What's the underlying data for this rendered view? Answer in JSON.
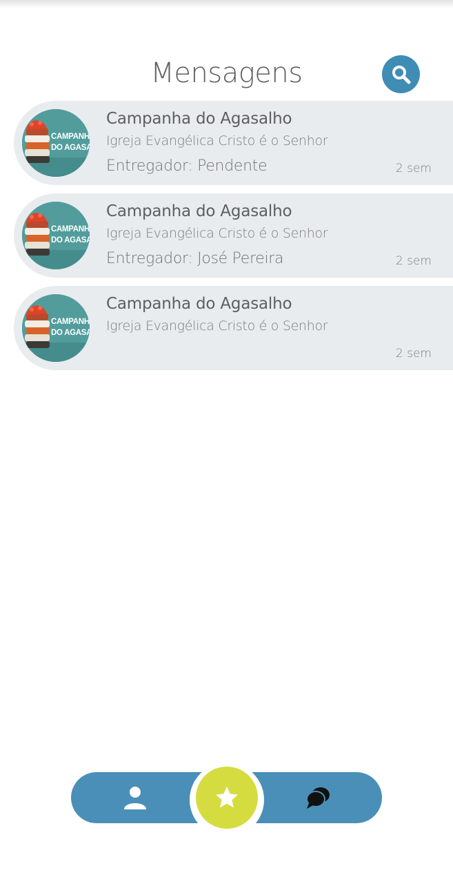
{
  "header": {
    "title": "Mensagens",
    "search_icon": "search-icon"
  },
  "messages": [
    {
      "title": "Campanha do Agasalho",
      "subtitle": "Igreja Evangélica Cristo é o Senhor",
      "deliverer": "Entregador: Pendente",
      "time": "2 sem",
      "avatar_text": [
        "CAMPANHA",
        "DO AGASALHO"
      ]
    },
    {
      "title": "Campanha do Agasalho",
      "subtitle": "Igreja Evangélica Cristo é o Senhor",
      "deliverer": "Entregador: José Pereira",
      "time": "2 sem",
      "avatar_text": [
        "CAMPANHA",
        "DO AGASALHO"
      ]
    },
    {
      "title": "Campanha do Agasalho",
      "subtitle": "Igreja Evangélica Cristo é o Senhor",
      "deliverer": "",
      "time": "2 sem",
      "avatar_text": [
        "CAMPANHA",
        "DO AGASALHO"
      ]
    }
  ],
  "bottom_nav": {
    "items": [
      {
        "icon": "profile-icon"
      },
      {
        "icon": "star-icon",
        "active": true
      },
      {
        "icon": "chat-icon"
      }
    ]
  },
  "colors": {
    "accent_blue": "#4a8fb8",
    "search_blue": "#3f8cb5",
    "favorite_yellow": "#d5dc40",
    "card_background": "#e8ecef",
    "avatar_teal": "#4a9696"
  }
}
